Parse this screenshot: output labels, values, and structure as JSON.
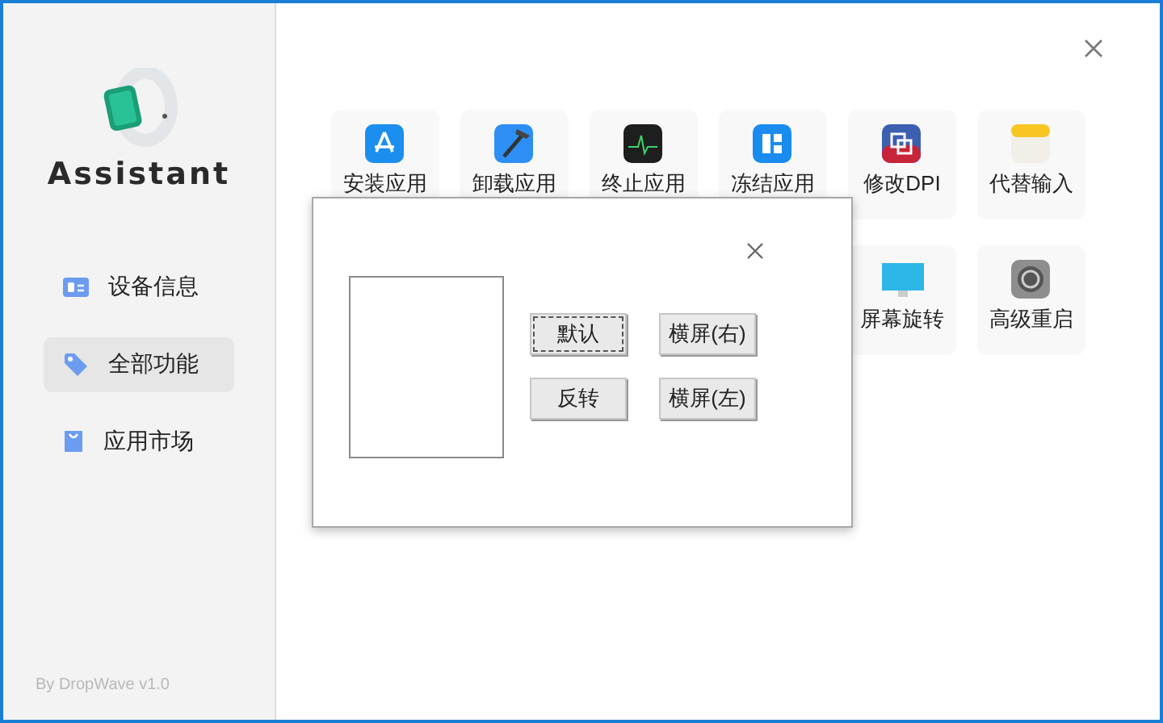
{
  "sidebar": {
    "logo_text": "Assistant",
    "items": [
      {
        "label": "设备信息",
        "selected": false
      },
      {
        "label": "全部功能",
        "selected": true
      },
      {
        "label": "应用市场",
        "selected": false
      }
    ],
    "footer": "By DropWave v1.0"
  },
  "tile_rows": [
    [
      {
        "label": "安装应用"
      },
      {
        "label": "卸载应用"
      },
      {
        "label": "终止应用"
      },
      {
        "label": "冻结应用"
      },
      {
        "label": "修改DPI"
      },
      {
        "label": "代替输入"
      }
    ],
    [
      {
        "label": "屏幕旋转"
      },
      {
        "label": "高级重启"
      }
    ]
  ],
  "dialog": {
    "buttons": [
      {
        "label": "默认",
        "focused": true
      },
      {
        "label": "横屏(右)",
        "focused": false
      },
      {
        "label": "反转",
        "focused": false
      },
      {
        "label": "横屏(左)",
        "focused": false
      }
    ]
  }
}
